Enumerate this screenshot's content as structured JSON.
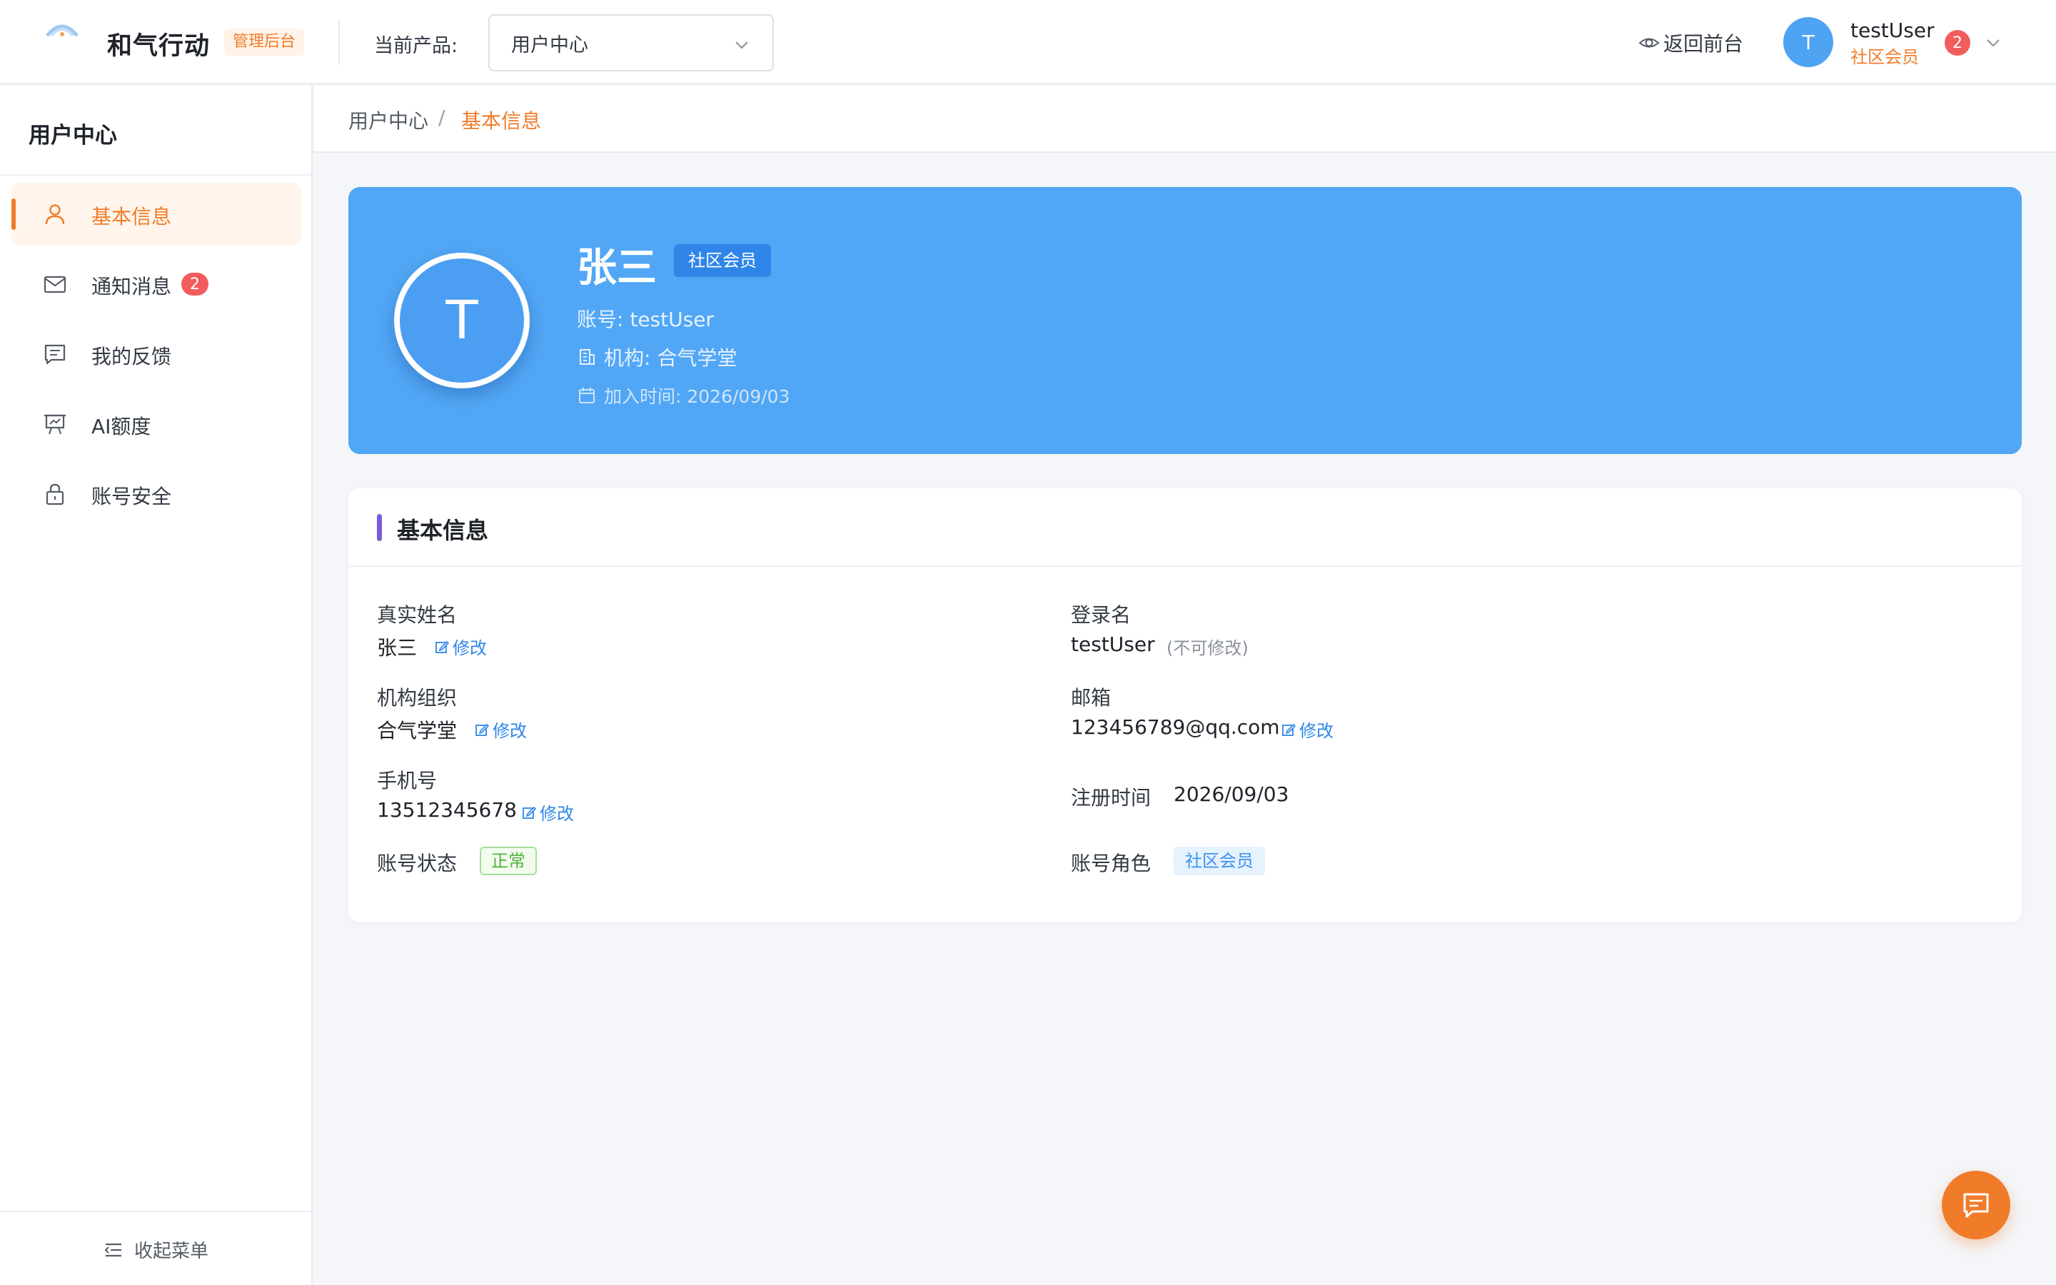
{
  "header": {
    "app_name": "和气行动",
    "admin_badge": "管理后台",
    "product_label": "当前产品:",
    "product_selected": "用户中心",
    "back_front": "返回前台",
    "user": {
      "avatar_letter": "T",
      "name": "testUser",
      "role": "社区会员",
      "notification_count": "2"
    }
  },
  "sidebar": {
    "title": "用户中心",
    "items": [
      {
        "label": "基本信息",
        "icon": "user-icon",
        "active": true
      },
      {
        "label": "通知消息",
        "icon": "mail-icon",
        "badge": "2"
      },
      {
        "label": "我的反馈",
        "icon": "feedback-icon"
      },
      {
        "label": "AI额度",
        "icon": "presentation-icon"
      },
      {
        "label": "账号安全",
        "icon": "lock-icon"
      }
    ],
    "collapse_label": "收起菜单"
  },
  "breadcrumb": {
    "items": [
      "用户中心",
      "基本信息"
    ],
    "separator": "/"
  },
  "profile": {
    "avatar_letter": "T",
    "name": "张三",
    "role_tag": "社区会员",
    "account_line": "账号: testUser",
    "org_line": "机构: 合气学堂",
    "joined_line": "加入时间: 2026/09/03"
  },
  "basic_info": {
    "title": "基本信息",
    "real_name_label": "真实姓名",
    "real_name": "张三",
    "login_name_label": "登录名",
    "login_name": "testUser",
    "login_name_note": "(不可修改)",
    "org_label": "机构组织",
    "org": "合气学堂",
    "email_label": "邮箱",
    "email": "123456789@qq.com",
    "phone_label": "手机号",
    "phone": "13512345678",
    "register_time_label": "注册时间",
    "register_time": "2026/09/03",
    "status_label": "账号状态",
    "status": "正常",
    "role_label": "账号角色",
    "role": "社区会员",
    "edit_label": "修改"
  },
  "colors": {
    "accent": "#f07c2a",
    "banner": "#51a7f5",
    "link": "#2f86e8",
    "badge_red": "#f25c5c",
    "status_green": "#52b13f"
  }
}
